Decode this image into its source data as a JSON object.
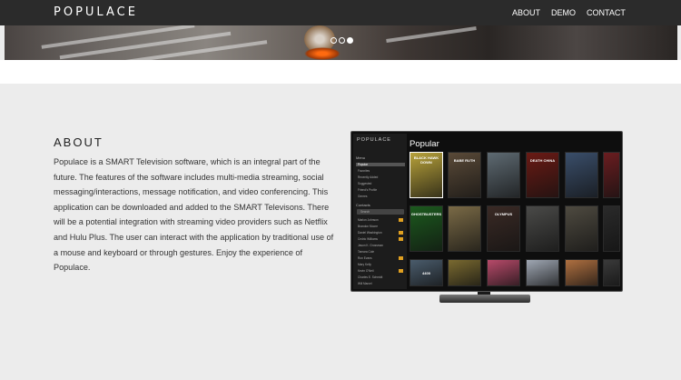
{
  "brand": "POPULACE",
  "nav": [
    {
      "id": "about",
      "label": "ABOUT"
    },
    {
      "id": "demo",
      "label": "DEMO"
    },
    {
      "id": "contact",
      "label": "CONTACT"
    }
  ],
  "carousel": {
    "slide_count": 3,
    "active_index": 2
  },
  "about": {
    "title": "ABOUT",
    "text": "Populace is a SMART Television software, which is an integral part of the future. The features of the software includes multi-media streaming, social messaging/interactions, message notification, and video conferencing. This application can be downloaded and added to the SMART Televisons. There will be a potential integration with streaming video providers such as Netflix and Hulu Plus. The user can interact with the application by traditional use of a mouse and keyboard or through gestures. Enjoy the experience of Populace."
  },
  "tv": {
    "logo": "POPULACE",
    "heading": "Popular",
    "menu_title": "Menu",
    "menu_items": [
      "Popular",
      "Favorites",
      "Recently Added",
      "Suggested",
      "Friend's Profile",
      "Genres"
    ],
    "contacts_title": "Contacts",
    "search_placeholder": "Search",
    "contacts": [
      "Marlon Johnson",
      "Brandon Moore",
      "Daniel Washington",
      "Cedric Williams",
      "Jason K. Grossman",
      "Tamara Cole",
      "Ron Evans",
      "Mary Kelly",
      "Kevin O'Neil",
      "Charles E. Schmidt",
      "Will Marcel"
    ],
    "posters": [
      {
        "title": "BLACK HAWK DOWN",
        "bg": "#b8a23a"
      },
      {
        "title": "BABE RUTH",
        "bg": "#5a4a38"
      },
      {
        "title": "",
        "bg": "#5e6a72"
      },
      {
        "title": "DEATH CHINA",
        "bg": "#6a1a14"
      },
      {
        "title": "",
        "bg": "#3a4e6a"
      },
      {
        "title": "",
        "bg": "#6a1d20"
      },
      {
        "title": "GHOSTBUSTERS",
        "bg": "#1c5a1e"
      },
      {
        "title": "",
        "bg": "#7a6a46"
      },
      {
        "title": "OLYMPUS",
        "bg": "#3a2a25"
      },
      {
        "title": "",
        "bg": "#4a4a48"
      },
      {
        "title": "",
        "bg": "#4e4a40"
      },
      {
        "title": "",
        "bg": "#2a2a2a"
      },
      {
        "title": "4400",
        "bg": "#4a5c6c"
      },
      {
        "title": "",
        "bg": "#7a6a30"
      },
      {
        "title": "",
        "bg": "#b84a6a"
      },
      {
        "title": "",
        "bg": "#a0a8b4"
      },
      {
        "title": "",
        "bg": "#b07040"
      },
      {
        "title": "",
        "bg": "#3a3a3a"
      }
    ]
  }
}
